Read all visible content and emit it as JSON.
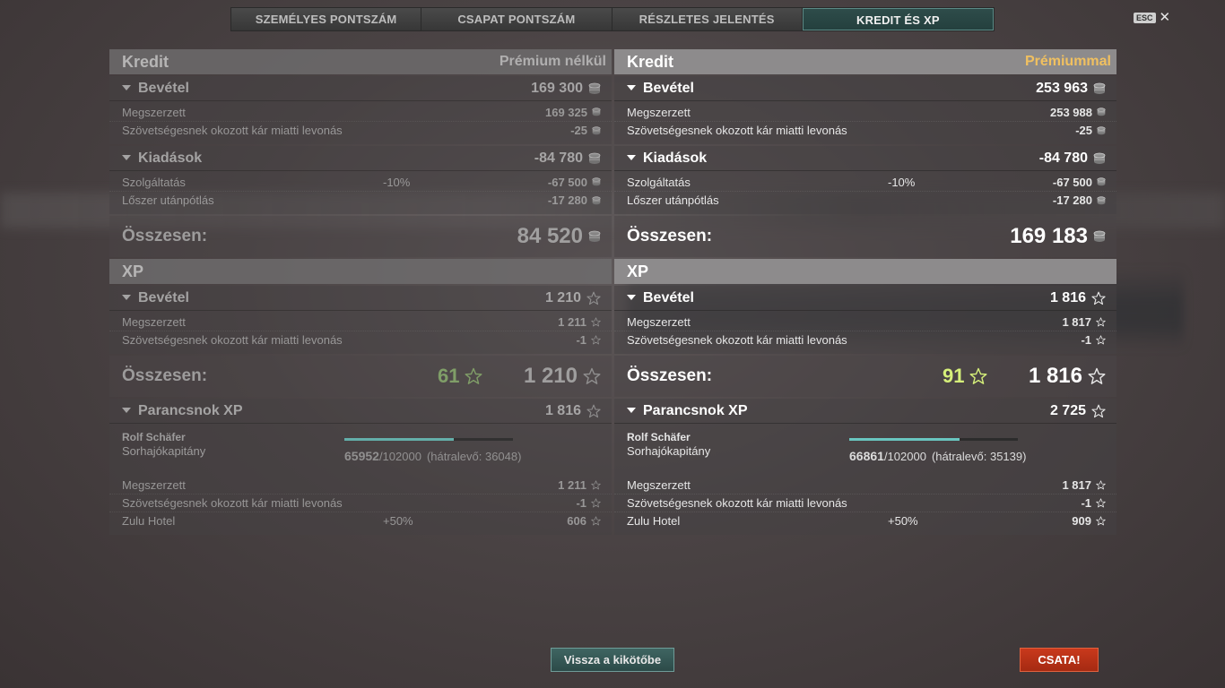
{
  "tabs": [
    {
      "label": "SZEMÉLYES PONTSZÁM"
    },
    {
      "label": "CSAPAT PONTSZÁM"
    },
    {
      "label": "RÉSZLETES JELENTÉS"
    },
    {
      "label": "KREDIT ÉS XP"
    }
  ],
  "active_tab": "KREDIT ÉS XP",
  "esc_label": "ESC",
  "colors": {
    "accent_teal": "#69c6c0",
    "premium_gold": "#f0c060",
    "battle_red": "#c9391c",
    "free_xp_green": "#d6f07a"
  },
  "left": {
    "credit_title": "Kredit",
    "variant": "Prémium nélkül",
    "income_label": "Bevétel",
    "income_total": "169 300",
    "income_rows": [
      {
        "label": "Megszerzett",
        "value": "169 325"
      },
      {
        "label": "Szövetségesnek okozott kár miatti levonás",
        "value": "-25"
      }
    ],
    "expense_label": "Kiadások",
    "expense_total": "-84 780",
    "expense_rows": [
      {
        "label": "Szolgáltatás",
        "pct": "-10%",
        "value": "-67 500"
      },
      {
        "label": "Lőszer utánpótlás",
        "pct": "",
        "value": "-17 280"
      }
    ],
    "credit_sum_label": "Összesen:",
    "credit_sum": "84 520",
    "xp_title": "XP",
    "xp_income_label": "Bevétel",
    "xp_income_total": "1 210",
    "xp_rows": [
      {
        "label": "Megszerzett",
        "value": "1 211"
      },
      {
        "label": "Szövetségesnek okozott kár miatti levonás",
        "value": "-1"
      }
    ],
    "xp_sum_label": "Összesen:",
    "xp_free": "61",
    "xp_sum": "1 210",
    "cmdr_label": "Parancsnok XP",
    "cmdr_total": "1 816",
    "cmdr_name": "Rolf Schäfer",
    "cmdr_rank": "Sorhajókapitány",
    "cmdr_xp_current": "65952",
    "cmdr_xp_max": "/102000",
    "cmdr_xp_remaining": "(hátralevő: 36048)",
    "cmdr_progress": 0.6466,
    "cmdr_rows": [
      {
        "label": "Megszerzett",
        "pct": "",
        "value": "1 211"
      },
      {
        "label": "Szövetségesnek okozott kár miatti levonás",
        "pct": "",
        "value": "-1"
      },
      {
        "label": "Zulu Hotel",
        "pct": "+50%",
        "value": "606"
      }
    ]
  },
  "right": {
    "credit_title": "Kredit",
    "variant": "Prémiummal",
    "income_label": "Bevétel",
    "income_total": "253 963",
    "income_rows": [
      {
        "label": "Megszerzett",
        "value": "253 988"
      },
      {
        "label": "Szövetségesnek okozott kár miatti levonás",
        "value": "-25"
      }
    ],
    "expense_label": "Kiadások",
    "expense_total": "-84 780",
    "expense_rows": [
      {
        "label": "Szolgáltatás",
        "pct": "-10%",
        "value": "-67 500"
      },
      {
        "label": "Lőszer utánpótlás",
        "pct": "",
        "value": "-17 280"
      }
    ],
    "credit_sum_label": "Összesen:",
    "credit_sum": "169 183",
    "xp_title": "XP",
    "xp_income_label": "Bevétel",
    "xp_income_total": "1 816",
    "xp_rows": [
      {
        "label": "Megszerzett",
        "value": "1 817"
      },
      {
        "label": "Szövetségesnek okozott kár miatti levonás",
        "value": "-1"
      }
    ],
    "xp_sum_label": "Összesen:",
    "xp_free": "91",
    "xp_sum": "1 816",
    "cmdr_label": "Parancsnok XP",
    "cmdr_total": "2 725",
    "cmdr_name": "Rolf Schäfer",
    "cmdr_rank": "Sorhajókapitány",
    "cmdr_xp_current": "66861",
    "cmdr_xp_max": "/102000",
    "cmdr_xp_remaining": "(hátralevő: 35139)",
    "cmdr_progress": 0.6555,
    "cmdr_rows": [
      {
        "label": "Megszerzett",
        "pct": "",
        "value": "1 817"
      },
      {
        "label": "Szövetségesnek okozott kár miatti levonás",
        "pct": "",
        "value": "-1"
      },
      {
        "label": "Zulu Hotel",
        "pct": "+50%",
        "value": "909"
      }
    ]
  },
  "buttons": {
    "back": "Vissza a kikötőbe",
    "battle": "CSATA!"
  }
}
